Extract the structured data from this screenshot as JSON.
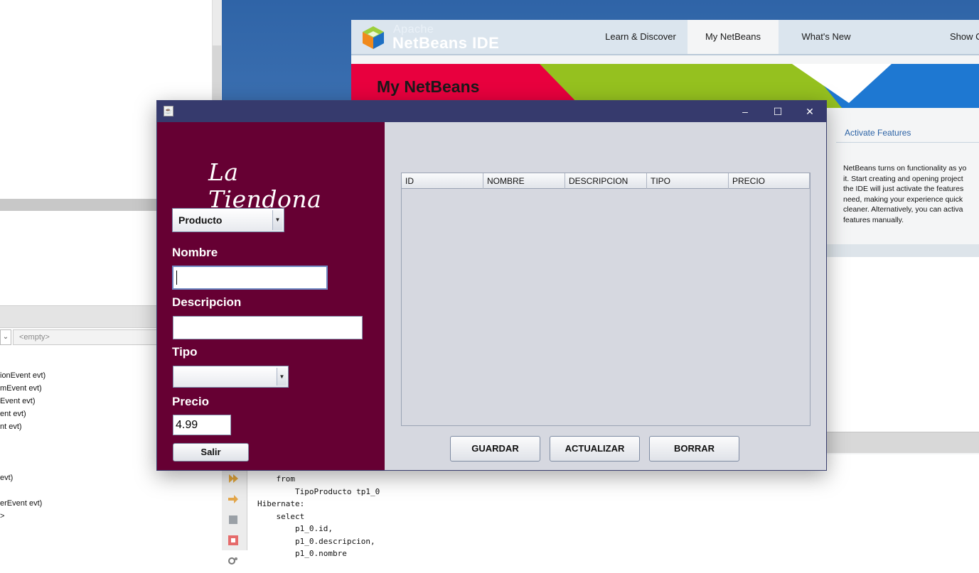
{
  "background": {
    "ide_left": {
      "empty_combo": "<empty>",
      "event_lines": [
        "ionEvent evt)",
        "mEvent evt)",
        "Event evt)",
        "ent evt)",
        "nt evt)",
        "",
        "",
        "",
        "evt)",
        "",
        "erEvent evt)",
        ">"
      ]
    },
    "code_lines": [
      "    from",
      "        TipoProducto tp1_0",
      "Hibernate:",
      "    select",
      "        p1_0.id,",
      "        p1_0.descripcion,",
      "        p1_0.nombre"
    ],
    "start_page": {
      "logo_apache": "Apache",
      "logo_product": "NetBeans IDE",
      "tabs": [
        "Learn & Discover",
        "My NetBeans",
        "What's New",
        "Show C"
      ],
      "banner_title": "My NetBeans",
      "side_title": "Activate Features",
      "side_text": "NetBeans turns on functionality as yo\nit. Start creating and opening project\nthe IDE will just activate the features\nneed, making your experience quick\ncleaner. Alternatively, you can activa\nfeatures manually.",
      "colors": {
        "banner_red": "#e8003e",
        "banner_green": "#95c11f",
        "banner_blue": "#1e78d2"
      }
    }
  },
  "dialog": {
    "title_controls": {
      "minimize": "–",
      "maximize": "☐",
      "close": "✕"
    },
    "brand_line1": "La",
    "brand_line2": "Tiendona",
    "entity_combo": "Producto",
    "labels": {
      "nombre": "Nombre",
      "descripcion": "Descripcion",
      "tipo": "Tipo",
      "precio": "Precio"
    },
    "values": {
      "nombre": "",
      "descripcion": "",
      "tipo": "",
      "precio": "4.99"
    },
    "buttons": {
      "salir": "Salir",
      "guardar": "GUARDAR",
      "actualizar": "ACTUALIZAR",
      "borrar": "BORRAR"
    },
    "table_columns": [
      "ID",
      "NOMBRE",
      "DESCRIPCION",
      "TIPO",
      "PRECIO"
    ],
    "colors": {
      "left_panel": "#660033",
      "title_bar": "#363a6d",
      "content": "#d6d8e0"
    }
  }
}
